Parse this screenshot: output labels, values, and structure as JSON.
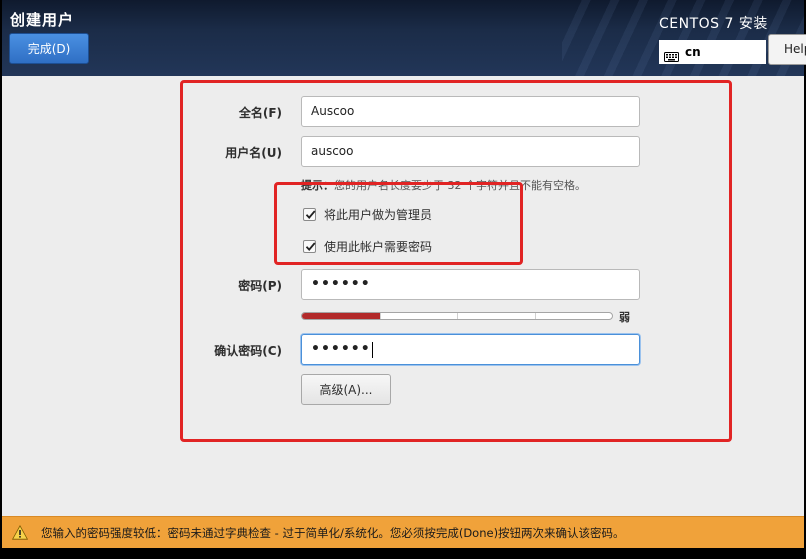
{
  "header": {
    "title": "创建用户",
    "done_label": "完成(D)",
    "product": "CENTOS 7 安装",
    "keyboard_layout": "cn",
    "help_label": "Help!"
  },
  "form": {
    "fullname_label": "全名(F)",
    "fullname_value": "Auscoo",
    "username_label": "用户名(U)",
    "username_value": "auscoo",
    "hint_prefix": "提示：",
    "hint_text": "您的用户名长度要少于 32 个字符并且不能有空格。",
    "admin_checkbox_label": "将此用户做为管理员",
    "admin_checked": true,
    "require_password_label": "使用此帐户需要密码",
    "require_password_checked": true,
    "password_label": "密码(P)",
    "password_mask": "••••••",
    "strength_label": "弱",
    "strength_fraction": 0.25,
    "confirm_label": "确认密码(C)",
    "confirm_mask": "••••••",
    "advanced_label": "高级(A)..."
  },
  "warning": {
    "text": "您输入的密码强度较低：密码未通过字典检查 - 过于简单化/系统化。您必须按完成(Done)按钮两次来确认该密码。"
  },
  "colors": {
    "accent_blue": "#2f6fc4",
    "warning_bg": "#f0a23a",
    "strength_weak": "#b22a2a",
    "annotation_red": "#e12424"
  }
}
